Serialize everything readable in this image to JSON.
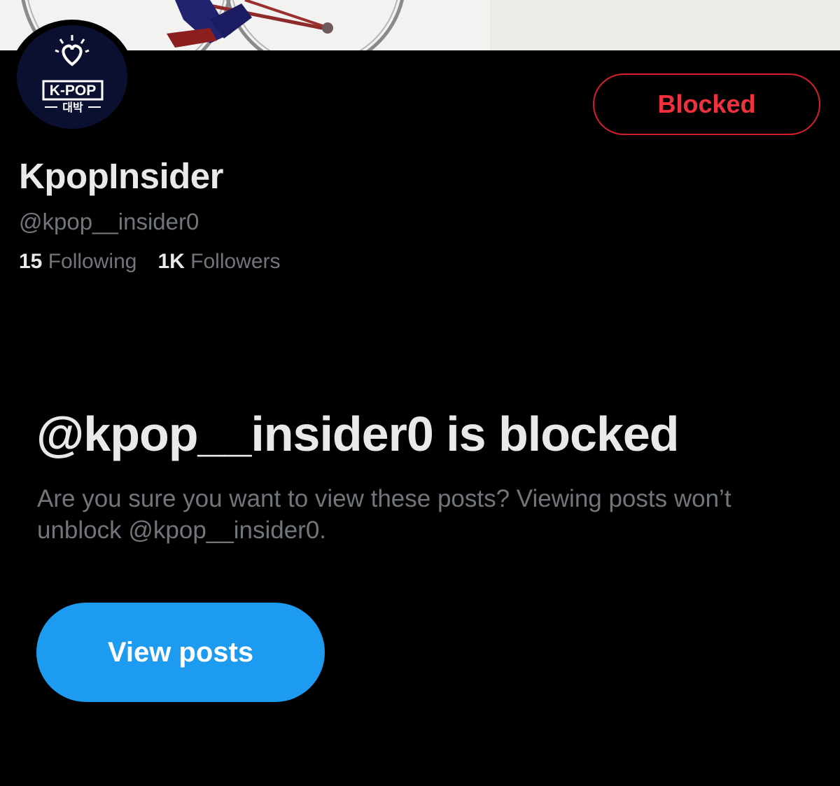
{
  "profile": {
    "display_name": "KpopInsider",
    "handle": "@kpop__insider0",
    "following_count": "15",
    "following_label": "Following",
    "followers_count": "1K",
    "followers_label": "Followers",
    "avatar_text_main": "K-POP",
    "avatar_text_sub": "대박"
  },
  "actions": {
    "blocked_label": "Blocked",
    "view_posts_label": "View posts"
  },
  "blocked_notice": {
    "title": "@kpop__insider0 is blocked",
    "description": "Are you sure you want to view these posts? Viewing posts won’t unblock @kpop__insider0."
  },
  "colors": {
    "background": "#000000",
    "accent": "#1d9bf0",
    "blocked": "#f0303c",
    "secondary_text": "#71767b"
  }
}
